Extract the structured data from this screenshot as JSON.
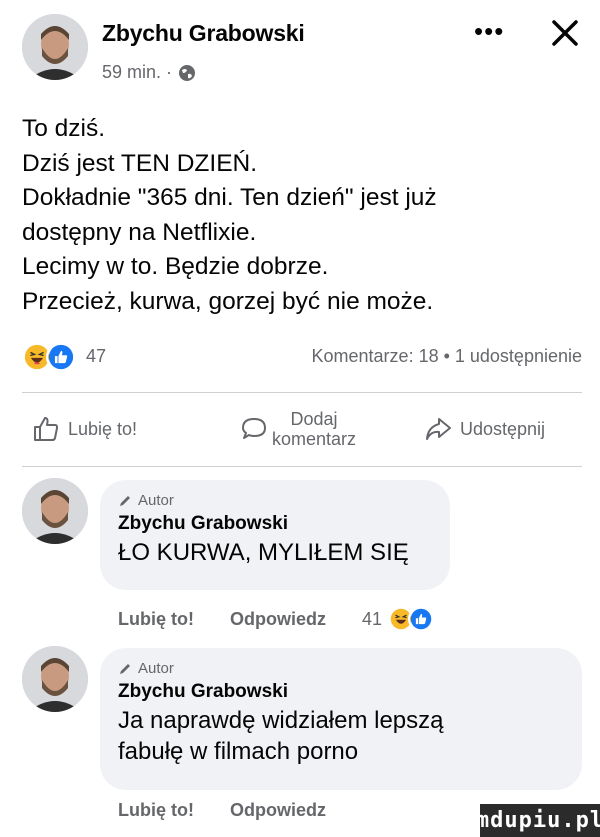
{
  "post": {
    "author": "Zbychu Grabowski",
    "time": "59 min. ·",
    "privacy_icon": "globe-icon",
    "text_lines": [
      "To dziś.",
      "Dziś jest TEN DZIEŃ.",
      "Dokładnie \"365 dni. Ten dzień\" jest już",
      "dostępny na Netflixie.",
      "Lecimy w to. Będzie dobrze.",
      "Przecież, kurwa, gorzej być nie może."
    ],
    "reactions": {
      "icons": [
        "haha-icon",
        "like-icon"
      ],
      "count": "47",
      "summary": "Komentarze: 18  •  1 udostępnienie"
    }
  },
  "header": {
    "more_label": "•••"
  },
  "actions": {
    "like": "Lubię to!",
    "comment_line1": "Dodaj",
    "comment_line2": "komentarz",
    "share": "Udostępnij"
  },
  "comments": [
    {
      "badge": "Autor",
      "author": "Zbychu Grabowski",
      "text_lines": [
        "ŁO KURWA, MYLIŁEM SIĘ"
      ],
      "like_label": "Lubię to!",
      "reply_label": "Odpowiedz",
      "reaction_count": "41"
    },
    {
      "badge": "Autor",
      "author": "Zbychu Grabowski",
      "text_lines": [
        "Ja naprawdę widziałem lepszą",
        "fabułę w filmach porno"
      ],
      "like_label": "Lubię to!",
      "reply_label": "Odpowiedz"
    }
  ],
  "watermark": "mdupiu.pl",
  "colors": {
    "like_blue": "#1877f2",
    "haha_yellow": "#f7b928",
    "secondary_text": "#65676b",
    "bubble_bg": "#f0f2f5"
  }
}
